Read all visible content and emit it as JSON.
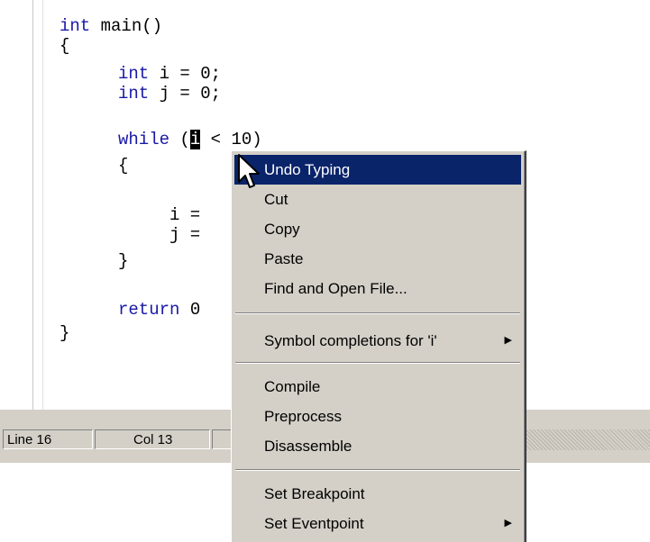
{
  "editor": {
    "lines": [
      {
        "kw": "int",
        "rest": " main()"
      },
      {
        "kw": "",
        "rest": "{"
      },
      {
        "kw": "int",
        "rest": " i = 0;"
      },
      {
        "kw": "int",
        "rest": " j = 0;"
      },
      {
        "kw": "while",
        "pre": " (",
        "cursor": "i",
        "post": " < 10)"
      },
      {
        "kw": "",
        "rest": "{"
      },
      {
        "kw": "",
        "rest": "i ="
      },
      {
        "kw": "",
        "rest": "j ="
      },
      {
        "kw": "",
        "rest": "}"
      },
      {
        "kw": "return",
        "rest": " 0"
      },
      {
        "kw": "",
        "rest": "}"
      }
    ]
  },
  "statusbar": {
    "line": "Line 16",
    "col": "Col 13"
  },
  "context_menu": {
    "items": [
      {
        "label": "Undo Typing"
      },
      {
        "label": "Cut"
      },
      {
        "label": "Copy"
      },
      {
        "label": "Paste"
      },
      {
        "label": "Find and Open File..."
      },
      {
        "label": "Symbol completions for 'i'"
      },
      {
        "label": "Compile"
      },
      {
        "label": "Preprocess"
      },
      {
        "label": "Disassemble"
      },
      {
        "label": "Set Breakpoint"
      },
      {
        "label": "Set Eventpoint"
      }
    ]
  },
  "colors": {
    "keyword": "#1a1aa6",
    "menu_bg": "#d4d0c8",
    "menu_selected": "#0a246a"
  }
}
